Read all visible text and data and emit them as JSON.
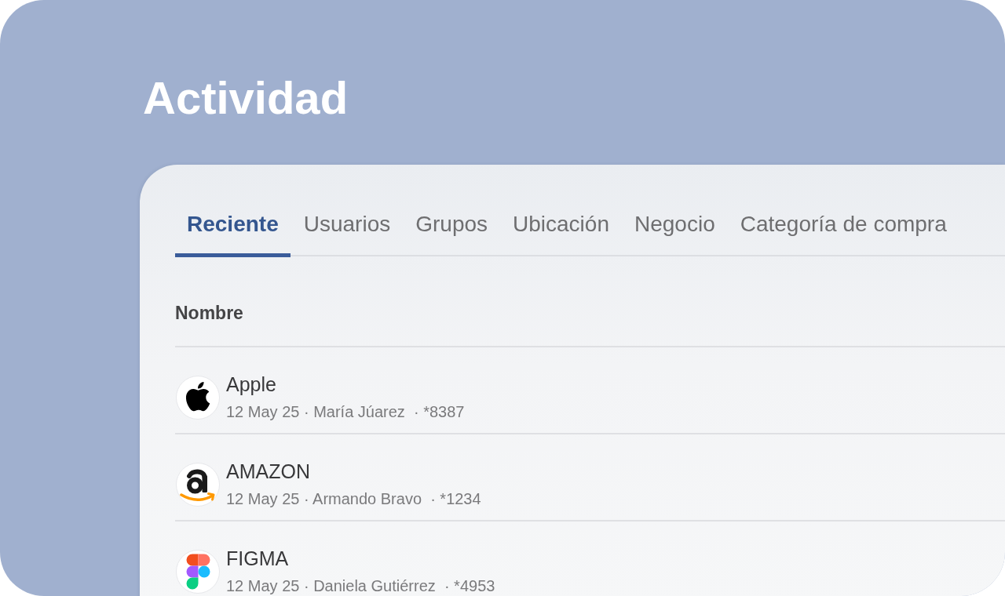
{
  "title": "Actividad",
  "tabs": [
    {
      "label": "Reciente",
      "selected": true
    },
    {
      "label": "Usuarios",
      "selected": false
    },
    {
      "label": "Grupos",
      "selected": false
    },
    {
      "label": "Ubicación",
      "selected": false
    },
    {
      "label": "Negocio",
      "selected": false
    },
    {
      "label": "Categoría de compra",
      "selected": false
    }
  ],
  "table": {
    "columns": [
      "Nombre"
    ],
    "rows": [
      {
        "kind": "apple",
        "name": "Apple",
        "details": "12 May 25 · María Júarez  · *8387"
      },
      {
        "kind": "amazon",
        "name": "AMAZON",
        "details": "12 May 25 · Armando Bravo  · *1234"
      },
      {
        "kind": "figma",
        "name": "FIGMA",
        "details": "12 May 25 · Daniela Gutiérrez  · *4953"
      }
    ]
  }
}
